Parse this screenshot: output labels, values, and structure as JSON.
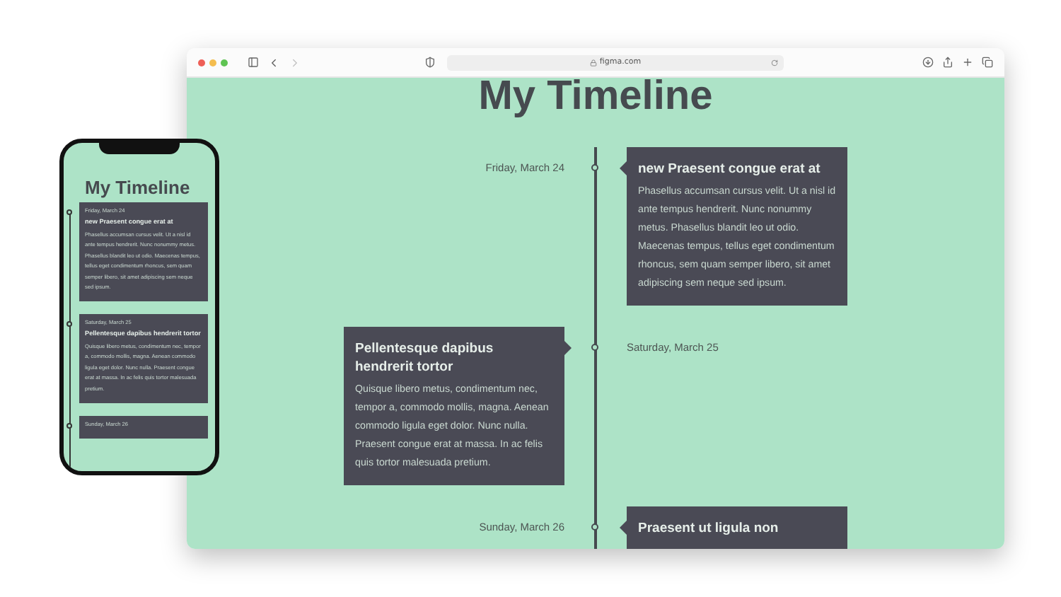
{
  "browser": {
    "url": "figma.com",
    "back_disabled": false,
    "forward_disabled": true
  },
  "desktop": {
    "title": "My Timeline",
    "events": [
      {
        "kind": "right",
        "date": "Friday, March 24",
        "title": "new Praesent congue erat at",
        "body": "Phasellus accumsan cursus velit. Ut a nisl id ante tempus hendrerit. Nunc nonummy metus. Phasellus blandit leo ut odio. Maecenas tempus, tellus eget condimentum rhoncus, sem quam semper libero, sit amet adipiscing sem neque sed ipsum."
      },
      {
        "kind": "left",
        "date": "Saturday, March 25",
        "title": "Pellentesque dapibus hendrerit tortor",
        "body": "Quisque libero metus, condimentum nec, tempor a, commodo mollis, magna. Aenean commodo ligula eget dolor. Nunc nulla. Praesent congue erat at massa. In ac felis quis tortor malesuada pretium."
      },
      {
        "kind": "right",
        "date": "Sunday, March 26",
        "title": "Praesent ut ligula non"
      }
    ]
  },
  "phone": {
    "title": "My Timeline",
    "events": [
      {
        "date": "Friday, March 24",
        "title": "new Praesent congue erat at",
        "body": "Phasellus accumsan cursus velit. Ut a nisl id ante tempus hendrerit. Nunc nonummy metus. Phasellus blandit leo ut odio. Maecenas tempus, tellus eget condimentum rhoncus, sem quam semper libero, sit amet adipiscing sem neque sed ipsum."
      },
      {
        "date": "Saturday, March 25",
        "title": "Pellentesque dapibus hendrerit tortor",
        "body": "Quisque libero metus, condimentum nec, tempor a, commodo mollis, magna. Aenean commodo ligula eget dolor. Nunc nulla. Praesent congue erat at massa. In ac felis quis tortor malesuada pretium."
      },
      {
        "date": "Sunday, March 26"
      }
    ]
  }
}
